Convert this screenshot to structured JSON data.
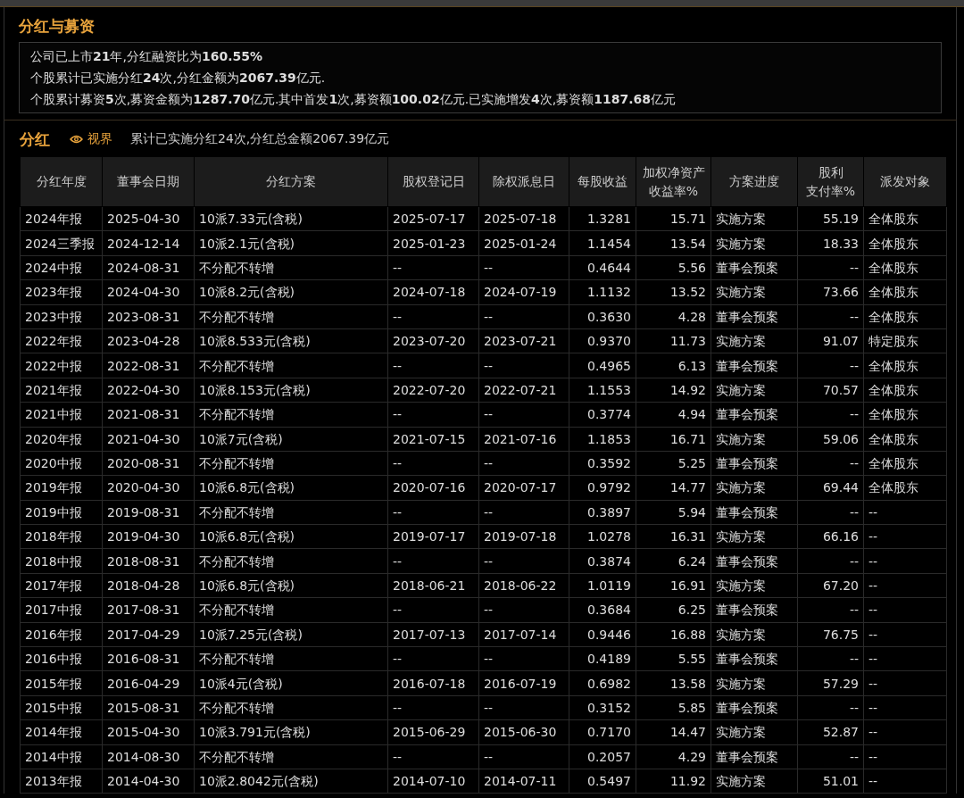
{
  "funding": {
    "title": "分红与募资",
    "lines": [
      "公司已上市**21**年,分红融资比为**160.55%**",
      "个股累计已实施分红**24**次,分红金额为**2067.39**亿元.",
      "个股累计募资**5**次,募资金额为**1287.70**亿元.其中首发**1**次,募资额**100.02**亿元.已实施增发**4**次,募资额**1187.68**亿元"
    ]
  },
  "dividend": {
    "title": "分红",
    "view_link": "视界",
    "summary": "累计已实施分红24次,分红总金额2067.39亿元",
    "columns": [
      {
        "lines": [
          "分红年度"
        ]
      },
      {
        "lines": [
          "董事会日期"
        ]
      },
      {
        "lines": [
          "分红方案"
        ]
      },
      {
        "lines": [
          "股权登记日"
        ]
      },
      {
        "lines": [
          "除权派息日"
        ]
      },
      {
        "lines": [
          "每股收益"
        ]
      },
      {
        "lines": [
          "加权净资产",
          "收益率%"
        ]
      },
      {
        "lines": [
          "方案进度"
        ]
      },
      {
        "lines": [
          "股利",
          "支付率%"
        ]
      },
      {
        "lines": [
          "派发对象"
        ]
      }
    ],
    "rows": [
      [
        "2024年报",
        "2025-04-30",
        "10派7.33元(含税)",
        "2025-07-17",
        "2025-07-18",
        "1.3281",
        "15.71",
        "实施方案",
        "55.19",
        "全体股东"
      ],
      [
        "2024三季报",
        "2024-12-14",
        "10派2.1元(含税)",
        "2025-01-23",
        "2025-01-24",
        "1.1454",
        "13.54",
        "实施方案",
        "18.33",
        "全体股东"
      ],
      [
        "2024中报",
        "2024-08-31",
        "不分配不转增",
        "--",
        "--",
        "0.4644",
        "5.56",
        "董事会预案",
        "--",
        "全体股东"
      ],
      [
        "2023年报",
        "2024-04-30",
        "10派8.2元(含税)",
        "2024-07-18",
        "2024-07-19",
        "1.1132",
        "13.52",
        "实施方案",
        "73.66",
        "全体股东"
      ],
      [
        "2023中报",
        "2023-08-31",
        "不分配不转增",
        "--",
        "--",
        "0.3630",
        "4.28",
        "董事会预案",
        "--",
        "全体股东"
      ],
      [
        "2022年报",
        "2023-04-28",
        "10派8.533元(含税)",
        "2023-07-20",
        "2023-07-21",
        "0.9370",
        "11.73",
        "实施方案",
        "91.07",
        "特定股东"
      ],
      [
        "2022中报",
        "2022-08-31",
        "不分配不转增",
        "--",
        "--",
        "0.4965",
        "6.13",
        "董事会预案",
        "--",
        "全体股东"
      ],
      [
        "2021年报",
        "2022-04-30",
        "10派8.153元(含税)",
        "2022-07-20",
        "2022-07-21",
        "1.1553",
        "14.92",
        "实施方案",
        "70.57",
        "全体股东"
      ],
      [
        "2021中报",
        "2021-08-31",
        "不分配不转增",
        "--",
        "--",
        "0.3774",
        "4.94",
        "董事会预案",
        "--",
        "全体股东"
      ],
      [
        "2020年报",
        "2021-04-30",
        "10派7元(含税)",
        "2021-07-15",
        "2021-07-16",
        "1.1853",
        "16.71",
        "实施方案",
        "59.06",
        "全体股东"
      ],
      [
        "2020中报",
        "2020-08-31",
        "不分配不转增",
        "--",
        "--",
        "0.3592",
        "5.25",
        "董事会预案",
        "--",
        "全体股东"
      ],
      [
        "2019年报",
        "2020-04-30",
        "10派6.8元(含税)",
        "2020-07-16",
        "2020-07-17",
        "0.9792",
        "14.77",
        "实施方案",
        "69.44",
        "全体股东"
      ],
      [
        "2019中报",
        "2019-08-31",
        "不分配不转增",
        "--",
        "--",
        "0.3897",
        "5.94",
        "董事会预案",
        "--",
        "--"
      ],
      [
        "2018年报",
        "2019-04-30",
        "10派6.8元(含税)",
        "2019-07-17",
        "2019-07-18",
        "1.0278",
        "16.31",
        "实施方案",
        "66.16",
        "--"
      ],
      [
        "2018中报",
        "2018-08-31",
        "不分配不转增",
        "--",
        "--",
        "0.3874",
        "6.24",
        "董事会预案",
        "--",
        "--"
      ],
      [
        "2017年报",
        "2018-04-28",
        "10派6.8元(含税)",
        "2018-06-21",
        "2018-06-22",
        "1.0119",
        "16.91",
        "实施方案",
        "67.20",
        "--"
      ],
      [
        "2017中报",
        "2017-08-31",
        "不分配不转增",
        "--",
        "--",
        "0.3684",
        "6.25",
        "董事会预案",
        "--",
        "--"
      ],
      [
        "2016年报",
        "2017-04-29",
        "10派7.25元(含税)",
        "2017-07-13",
        "2017-07-14",
        "0.9446",
        "16.88",
        "实施方案",
        "76.75",
        "--"
      ],
      [
        "2016中报",
        "2016-08-31",
        "不分配不转增",
        "--",
        "--",
        "0.4189",
        "5.55",
        "董事会预案",
        "--",
        "--"
      ],
      [
        "2015年报",
        "2016-04-29",
        "10派4元(含税)",
        "2016-07-18",
        "2016-07-19",
        "0.6982",
        "13.58",
        "实施方案",
        "57.29",
        "--"
      ],
      [
        "2015中报",
        "2015-08-31",
        "不分配不转增",
        "--",
        "--",
        "0.3152",
        "5.85",
        "董事会预案",
        "--",
        "--"
      ],
      [
        "2014年报",
        "2015-04-30",
        "10派3.791元(含税)",
        "2015-06-29",
        "2015-06-30",
        "0.7170",
        "14.47",
        "实施方案",
        "52.87",
        "--"
      ],
      [
        "2014中报",
        "2014-08-30",
        "不分配不转增",
        "--",
        "--",
        "0.2057",
        "4.29",
        "董事会预案",
        "--",
        "--"
      ],
      [
        "2013年报",
        "2014-04-30",
        "10派2.8042元(含税)",
        "2014-07-10",
        "2014-07-11",
        "0.5497",
        "11.92",
        "实施方案",
        "51.01",
        "--"
      ]
    ]
  }
}
